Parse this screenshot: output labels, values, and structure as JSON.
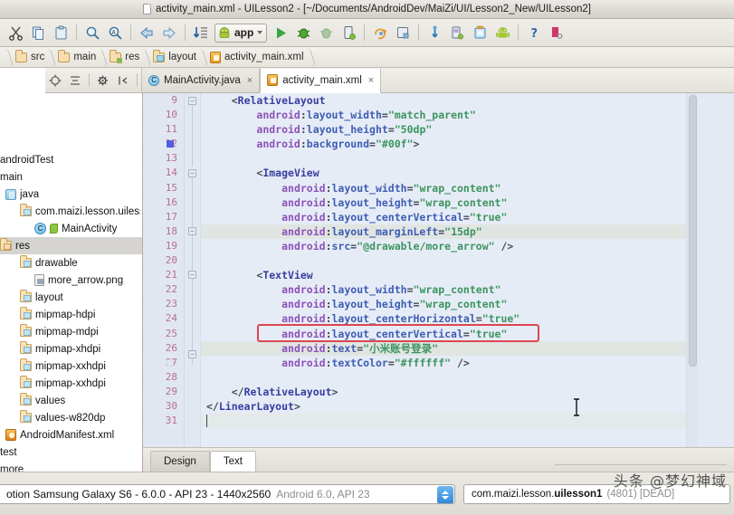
{
  "window": {
    "title": "activity_main.xml - UILesson2 - [~/Documents/AndroidDev/MaiZi/UI/Lesson2_New/UILesson2]",
    "doc_icon": "xml-file-icon"
  },
  "toolbar": {
    "items": [
      {
        "name": "cut-button",
        "icon": "scissors-icon"
      },
      {
        "name": "copy-button",
        "icon": "copy-icon"
      },
      {
        "name": "paste-button",
        "icon": "clipboard-icon"
      },
      {
        "name": "find-button",
        "icon": "magnifier-icon"
      },
      {
        "name": "replace-button",
        "icon": "magnifier-replace-icon"
      },
      {
        "name": "back-button",
        "icon": "arrow-left-icon"
      },
      {
        "name": "forward-button",
        "icon": "arrow-right-icon"
      },
      {
        "name": "sync-button",
        "icon": "sync-down-icon"
      }
    ],
    "run_config": {
      "label": "app",
      "icon": "android-head-icon",
      "dropdown": "chevron-down-icon"
    },
    "actions": [
      {
        "name": "run-button",
        "icon": "play-green-icon"
      },
      {
        "name": "debug-button",
        "icon": "bug-green-icon"
      },
      {
        "name": "attach-debugger-button",
        "icon": "attach-debugger-icon"
      },
      {
        "name": "instant-run-button",
        "icon": "device-run-icon"
      },
      {
        "name": "sync-gradle-button",
        "icon": "gradle-sync-icon"
      },
      {
        "name": "avd-manager-button",
        "icon": "avd-manager-icon"
      },
      {
        "name": "layout-inspector-button",
        "icon": "layout-inspector-icon"
      },
      {
        "name": "sdk-manager-button",
        "icon": "sdk-manager-icon"
      },
      {
        "name": "device-monitor-button",
        "icon": "device-monitor-icon"
      },
      {
        "name": "android-button",
        "icon": "android-robot-icon"
      },
      {
        "name": "help-button",
        "icon": "question-mark-icon"
      },
      {
        "name": "search-everywhere-button",
        "icon": "search-magnifier-icon"
      }
    ]
  },
  "breadcrumb": {
    "items": [
      {
        "label": "",
        "icon": "project-icon"
      },
      {
        "label": "src",
        "icon": "folder-icon"
      },
      {
        "label": "main",
        "icon": "folder-icon"
      },
      {
        "label": "res",
        "icon": "res-folder-icon"
      },
      {
        "label": "layout",
        "icon": "layout-folder-icon"
      },
      {
        "label": "activity_main.xml",
        "icon": "xml-file-icon"
      }
    ]
  },
  "project_tree": {
    "nodes": [
      {
        "label": "androidTest",
        "indent": 0,
        "icon": "none",
        "selected": false
      },
      {
        "label": "main",
        "indent": 0,
        "icon": "none",
        "selected": false
      },
      {
        "label": "java",
        "indent": 1,
        "icon": "java-folder-icon",
        "selected": false
      },
      {
        "label": "com.maizi.lesson.uiless",
        "indent": 2,
        "icon": "package-icon",
        "selected": false
      },
      {
        "label": "MainActivity",
        "indent": 3,
        "icon": "class-icon",
        "selected": false
      },
      {
        "label": "res",
        "indent": 0,
        "icon": "res-folder-icon",
        "selected": true
      },
      {
        "label": "drawable",
        "indent": 2,
        "icon": "folder-icon",
        "selected": false
      },
      {
        "label": "more_arrow.png",
        "indent": 3,
        "icon": "image-file-icon",
        "selected": false
      },
      {
        "label": "layout",
        "indent": 2,
        "icon": "folder-icon",
        "selected": false
      },
      {
        "label": "mipmap-hdpi",
        "indent": 2,
        "icon": "folder-icon",
        "selected": false
      },
      {
        "label": "mipmap-mdpi",
        "indent": 2,
        "icon": "folder-icon",
        "selected": false
      },
      {
        "label": "mipmap-xhdpi",
        "indent": 2,
        "icon": "folder-icon",
        "selected": false
      },
      {
        "label": "mipmap-xxhdpi",
        "indent": 2,
        "icon": "folder-icon",
        "selected": false
      },
      {
        "label": "mipmap-xxhdpi",
        "indent": 2,
        "icon": "folder-icon",
        "selected": false
      },
      {
        "label": "values",
        "indent": 2,
        "icon": "folder-icon",
        "selected": false
      },
      {
        "label": "values-w820dp",
        "indent": 2,
        "icon": "folder-icon",
        "selected": false
      },
      {
        "label": "AndroidManifest.xml",
        "indent": 1,
        "icon": "manifest-icon",
        "selected": false
      },
      {
        "label": "test",
        "indent": 0,
        "icon": "none",
        "selected": false
      },
      {
        "label": "more",
        "indent": 0,
        "icon": "none",
        "selected": false
      }
    ]
  },
  "editor_tabs": {
    "tools": [
      {
        "name": "locate-button",
        "icon": "crosshair-icon"
      },
      {
        "name": "collapse-all-button",
        "icon": "collapse-icon"
      },
      {
        "name": "settings-button",
        "icon": "gear-icon"
      },
      {
        "name": "hide-button",
        "icon": "hide-panel-icon"
      }
    ],
    "tabs": [
      {
        "label": "MainActivity.java",
        "icon": "java-class-icon",
        "active": false,
        "close": "×"
      },
      {
        "label": "activity_main.xml",
        "icon": "xml-file-icon",
        "active": true,
        "close": "×"
      }
    ]
  },
  "code": {
    "first_line_number": 9,
    "lines": [
      {
        "num": 9,
        "indent": 4,
        "tokens": [
          {
            "t": "punc",
            "v": "<"
          },
          {
            "t": "tag",
            "v": "RelativeLayout"
          }
        ],
        "highlight": "none"
      },
      {
        "num": 10,
        "indent": 8,
        "tokens": [
          {
            "t": "ns",
            "v": "android"
          },
          {
            "t": "punc",
            "v": ":"
          },
          {
            "t": "attr",
            "v": "layout_width"
          },
          {
            "t": "punc",
            "v": "="
          },
          {
            "t": "val",
            "v": "\"match_parent\""
          }
        ],
        "highlight": "none"
      },
      {
        "num": 11,
        "indent": 8,
        "tokens": [
          {
            "t": "ns",
            "v": "android"
          },
          {
            "t": "punc",
            "v": ":"
          },
          {
            "t": "attr",
            "v": "layout_height"
          },
          {
            "t": "punc",
            "v": "="
          },
          {
            "t": "val",
            "v": "\"50dp\""
          }
        ],
        "highlight": "none"
      },
      {
        "num": 12,
        "indent": 8,
        "tokens": [
          {
            "t": "ns",
            "v": "android"
          },
          {
            "t": "punc",
            "v": ":"
          },
          {
            "t": "attr",
            "v": "background"
          },
          {
            "t": "punc",
            "v": "="
          },
          {
            "t": "val",
            "v": "\"#00f\""
          },
          {
            "t": "punc",
            "v": ">"
          }
        ],
        "highlight": "none",
        "breakpoint": "blue"
      },
      {
        "num": 13,
        "indent": 0,
        "tokens": [],
        "highlight": "none"
      },
      {
        "num": 14,
        "indent": 8,
        "tokens": [
          {
            "t": "punc",
            "v": "<"
          },
          {
            "t": "tag",
            "v": "ImageView"
          }
        ],
        "highlight": "none"
      },
      {
        "num": 15,
        "indent": 12,
        "tokens": [
          {
            "t": "ns",
            "v": "android"
          },
          {
            "t": "punc",
            "v": ":"
          },
          {
            "t": "attr",
            "v": "layout_width"
          },
          {
            "t": "punc",
            "v": "="
          },
          {
            "t": "val",
            "v": "\"wrap_content\""
          }
        ],
        "highlight": "none"
      },
      {
        "num": 16,
        "indent": 12,
        "tokens": [
          {
            "t": "ns",
            "v": "android"
          },
          {
            "t": "punc",
            "v": ":"
          },
          {
            "t": "attr",
            "v": "layout_height"
          },
          {
            "t": "punc",
            "v": "="
          },
          {
            "t": "val",
            "v": "\"wrap_content\""
          }
        ],
        "highlight": "none"
      },
      {
        "num": 17,
        "indent": 12,
        "tokens": [
          {
            "t": "ns",
            "v": "android"
          },
          {
            "t": "punc",
            "v": ":"
          },
          {
            "t": "attr",
            "v": "layout_centerVertical"
          },
          {
            "t": "punc",
            "v": "="
          },
          {
            "t": "val",
            "v": "\"true\""
          }
        ],
        "highlight": "none"
      },
      {
        "num": 18,
        "indent": 12,
        "tokens": [
          {
            "t": "ns",
            "v": "android"
          },
          {
            "t": "punc",
            "v": ":"
          },
          {
            "t": "attr",
            "v": "layout_marginLeft"
          },
          {
            "t": "punc",
            "v": "="
          },
          {
            "t": "val",
            "v": "\"15dp\""
          }
        ],
        "highlight": "soft"
      },
      {
        "num": 19,
        "indent": 12,
        "tokens": [
          {
            "t": "ns",
            "v": "android"
          },
          {
            "t": "punc",
            "v": ":"
          },
          {
            "t": "attr",
            "v": "src"
          },
          {
            "t": "punc",
            "v": "="
          },
          {
            "t": "val",
            "v": "\"@drawable/more_arrow\""
          },
          {
            "t": "punc",
            "v": " />"
          }
        ],
        "highlight": "none"
      },
      {
        "num": 20,
        "indent": 0,
        "tokens": [],
        "highlight": "none"
      },
      {
        "num": 21,
        "indent": 8,
        "tokens": [
          {
            "t": "punc",
            "v": "<"
          },
          {
            "t": "tag",
            "v": "TextView"
          }
        ],
        "highlight": "none"
      },
      {
        "num": 22,
        "indent": 12,
        "tokens": [
          {
            "t": "ns",
            "v": "android"
          },
          {
            "t": "punc",
            "v": ":"
          },
          {
            "t": "attr",
            "v": "layout_width"
          },
          {
            "t": "punc",
            "v": "="
          },
          {
            "t": "val",
            "v": "\"wrap_content\""
          }
        ],
        "highlight": "none"
      },
      {
        "num": 23,
        "indent": 12,
        "tokens": [
          {
            "t": "ns",
            "v": "android"
          },
          {
            "t": "punc",
            "v": ":"
          },
          {
            "t": "attr",
            "v": "layout_height"
          },
          {
            "t": "punc",
            "v": "="
          },
          {
            "t": "val",
            "v": "\"wrap_content\""
          }
        ],
        "highlight": "none"
      },
      {
        "num": 24,
        "indent": 12,
        "tokens": [
          {
            "t": "ns",
            "v": "android"
          },
          {
            "t": "punc",
            "v": ":"
          },
          {
            "t": "attr",
            "v": "layout_centerHorizontal"
          },
          {
            "t": "punc",
            "v": "="
          },
          {
            "t": "val",
            "v": "\"true\""
          }
        ],
        "highlight": "none"
      },
      {
        "num": 25,
        "indent": 12,
        "tokens": [
          {
            "t": "ns",
            "v": "android"
          },
          {
            "t": "punc",
            "v": ":"
          },
          {
            "t": "attr",
            "v": "layout_centerVertical"
          },
          {
            "t": "punc",
            "v": "="
          },
          {
            "t": "val",
            "v": "\"true\""
          }
        ],
        "highlight": "boxed"
      },
      {
        "num": 26,
        "indent": 12,
        "tokens": [
          {
            "t": "ns",
            "v": "android"
          },
          {
            "t": "punc",
            "v": ":"
          },
          {
            "t": "attr",
            "v": "text"
          },
          {
            "t": "punc",
            "v": "="
          },
          {
            "t": "val",
            "v": "\"小米账号登录\""
          }
        ],
        "highlight": "soft"
      },
      {
        "num": 27,
        "indent": 12,
        "tokens": [
          {
            "t": "ns",
            "v": "android"
          },
          {
            "t": "punc",
            "v": ":"
          },
          {
            "t": "attr",
            "v": "textColor"
          },
          {
            "t": "punc",
            "v": "="
          },
          {
            "t": "val",
            "v": "\"#ffffff\""
          },
          {
            "t": "punc",
            "v": " />"
          }
        ],
        "highlight": "none",
        "breakpoint": "white"
      },
      {
        "num": 28,
        "indent": 0,
        "tokens": [],
        "highlight": "none"
      },
      {
        "num": 29,
        "indent": 4,
        "tokens": [
          {
            "t": "punc",
            "v": "</"
          },
          {
            "t": "tag",
            "v": "RelativeLayout"
          },
          {
            "t": "punc",
            "v": ">"
          }
        ],
        "highlight": "none"
      },
      {
        "num": 30,
        "indent": 0,
        "tokens": [
          {
            "t": "punc",
            "v": "</"
          },
          {
            "t": "tag",
            "v": "LinearLayout"
          },
          {
            "t": "punc",
            "v": ">"
          }
        ],
        "highlight": "none"
      },
      {
        "num": 31,
        "indent": 0,
        "tokens": [],
        "highlight": "caret"
      }
    ],
    "annotation": {
      "type": "red-rectangle",
      "color": "#ee1111",
      "target_line": 25,
      "target_text": "android:layout_centerVertical=\"true\""
    }
  },
  "design_text_tabs": {
    "tabs": [
      {
        "label": "Design",
        "active": false
      },
      {
        "label": "Text",
        "active": true
      }
    ]
  },
  "bottom_bar": {
    "device": {
      "text": "otion Samsung Galaxy S6 - 6.0.0 - API 23 - 1440x2560",
      "muted": "Android 6.0, API 23"
    },
    "process": {
      "prefix": "com.maizi.lesson.",
      "bold": "uilesson1",
      "muted": "(4801) [DEAD]"
    }
  },
  "watermark": {
    "text": "头条 @梦幻神域"
  },
  "colors": {
    "accent_blue": "#2f86d8",
    "annotation_red": "#ee1111",
    "tag": "#000080",
    "attribute": "#0b2f9e",
    "namespace": "#7a1fa2",
    "value": "#087f23",
    "line_number": "#b94a6e"
  }
}
